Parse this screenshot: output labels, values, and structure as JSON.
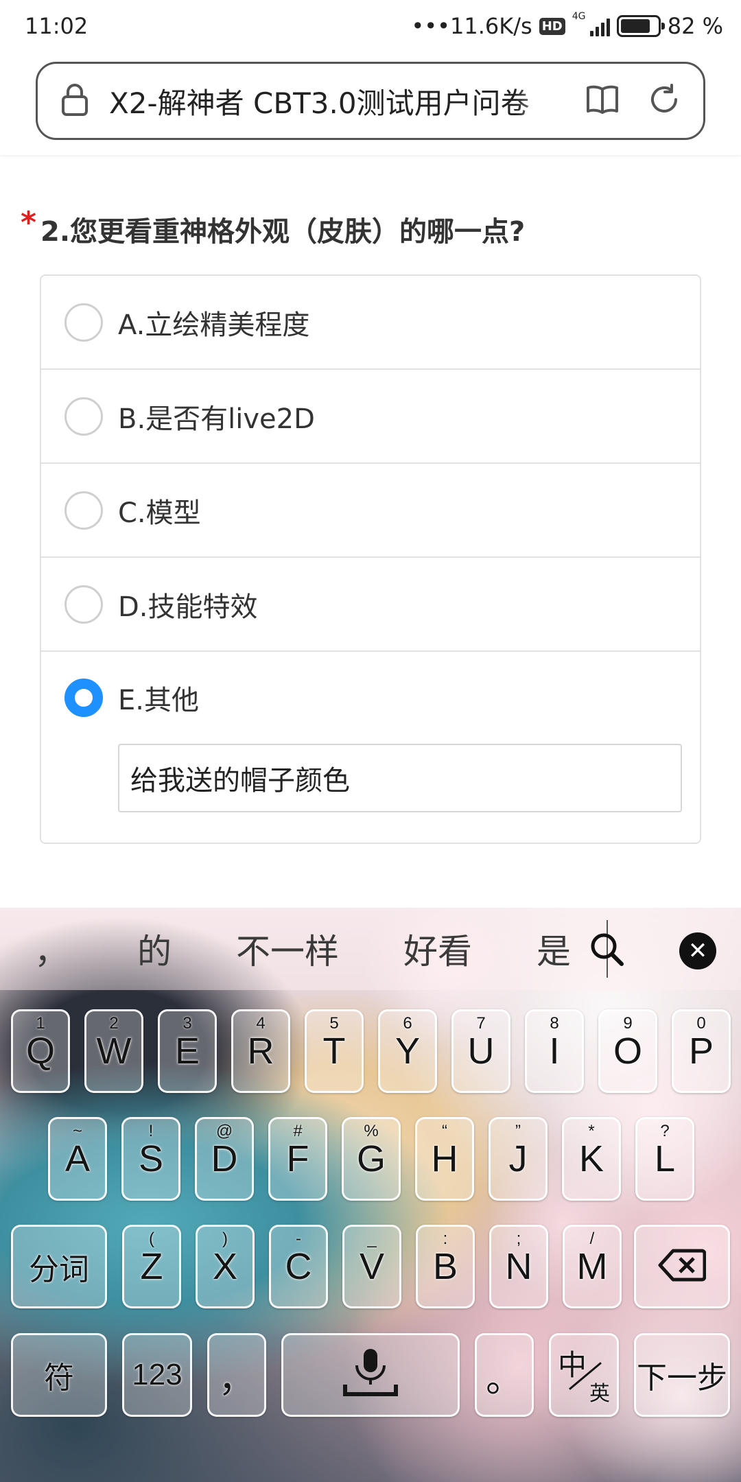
{
  "status_bar": {
    "time": "11:02",
    "net_speed": "•••11.6K/s",
    "hd_badge": "HD",
    "network_type": "4G",
    "battery_level": 82,
    "battery_text": "82 %"
  },
  "browser": {
    "url_title": "X2-解神者 CBT3.0测试用户问卷",
    "icons": [
      "lock-icon",
      "reader-mode-icon",
      "refresh-icon"
    ]
  },
  "question": {
    "required_mark": "*",
    "title": "2.您更看重神格外观（皮肤）的哪一点?",
    "options": [
      {
        "label": "A.立绘精美程度",
        "checked": false
      },
      {
        "label": "B.是否有live2D",
        "checked": false
      },
      {
        "label": "C.模型",
        "checked": false
      },
      {
        "label": "D.技能特效",
        "checked": false
      },
      {
        "label": "E.其他",
        "checked": true
      }
    ],
    "other_input_value": "给我送的帽子颜色"
  },
  "keyboard": {
    "candidates": [
      "，",
      "的",
      "不一样",
      "好看",
      "是"
    ],
    "row1": [
      {
        "main": "Q",
        "sub": "1"
      },
      {
        "main": "W",
        "sub": "2"
      },
      {
        "main": "E",
        "sub": "3"
      },
      {
        "main": "R",
        "sub": "4"
      },
      {
        "main": "T",
        "sub": "5"
      },
      {
        "main": "Y",
        "sub": "6"
      },
      {
        "main": "U",
        "sub": "7"
      },
      {
        "main": "I",
        "sub": "8"
      },
      {
        "main": "O",
        "sub": "9"
      },
      {
        "main": "P",
        "sub": "0"
      }
    ],
    "row2": [
      {
        "main": "A",
        "sub": "~"
      },
      {
        "main": "S",
        "sub": "!"
      },
      {
        "main": "D",
        "sub": "@"
      },
      {
        "main": "F",
        "sub": "#"
      },
      {
        "main": "G",
        "sub": "%"
      },
      {
        "main": "H",
        "sub": "“"
      },
      {
        "main": "J",
        "sub": "”"
      },
      {
        "main": "K",
        "sub": "*"
      },
      {
        "main": "L",
        "sub": "?"
      }
    ],
    "row3": [
      {
        "main": "Z",
        "sub": "("
      },
      {
        "main": "X",
        "sub": ")"
      },
      {
        "main": "C",
        "sub": "-"
      },
      {
        "main": "V",
        "sub": "_"
      },
      {
        "main": "B",
        "sub": ":"
      },
      {
        "main": "N",
        "sub": ";"
      },
      {
        "main": "M",
        "sub": "/"
      }
    ],
    "segment_key": "分词",
    "symbol_key": "符",
    "number_key": "123",
    "comma_key": "，",
    "period_key": "。",
    "lang_key_zh": "中",
    "lang_key_en": "英",
    "next_key": "下一步"
  }
}
